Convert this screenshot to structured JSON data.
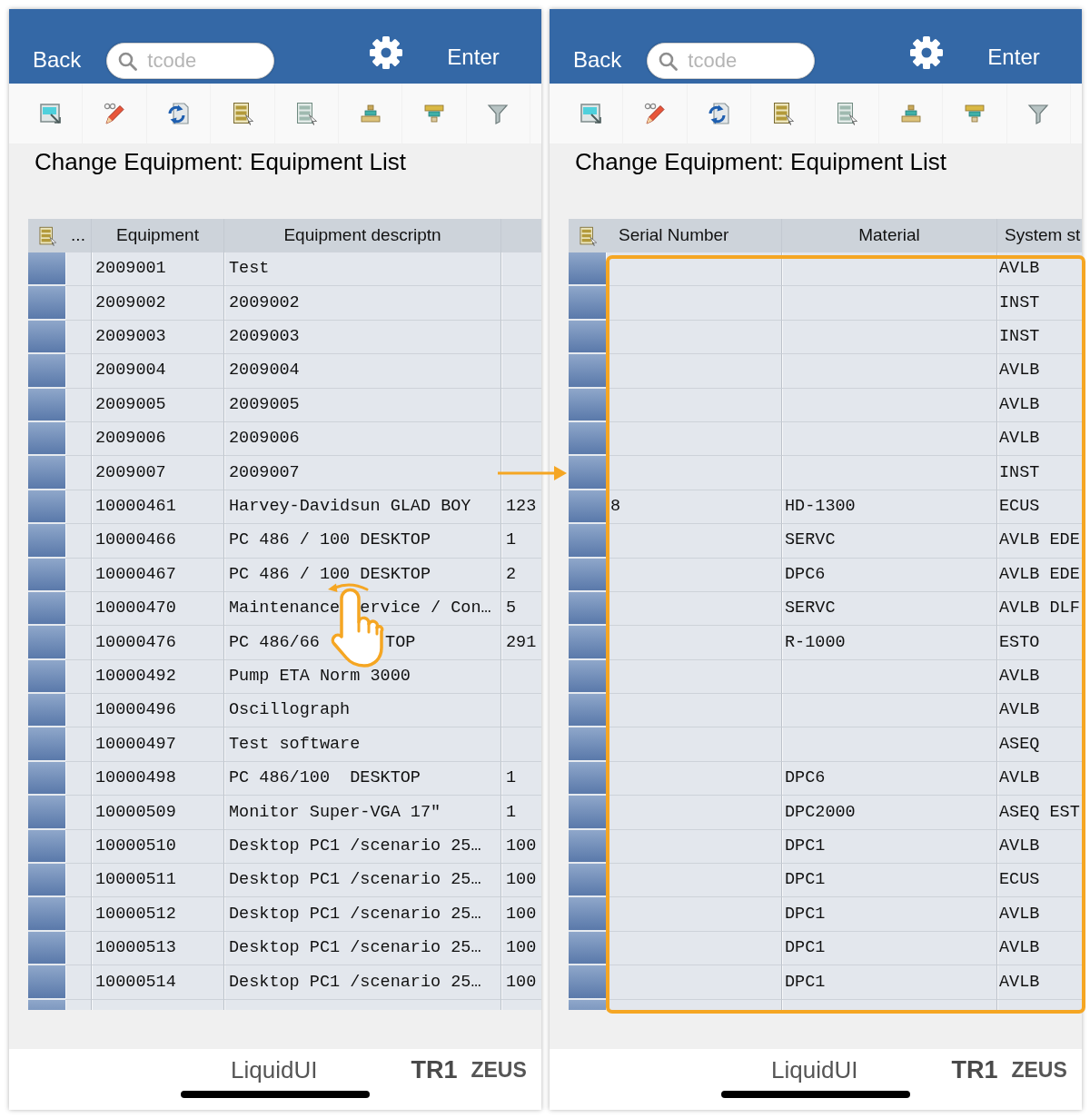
{
  "screens": [
    {
      "back_button": "Back",
      "search": {
        "placeholder": "tcode"
      },
      "enter_button": "Enter",
      "title": "Change Equipment: Equipment List",
      "table": {
        "columns": [
          "...",
          "Equipment",
          "Equipment descriptn"
        ],
        "rows": [
          {
            "selected": false,
            "equipment": "2009001",
            "description": "Test"
          },
          {
            "selected": false,
            "equipment": "2009002",
            "description": "2009002"
          },
          {
            "selected": false,
            "equipment": "2009003",
            "description": "2009003"
          },
          {
            "selected": false,
            "equipment": "2009004",
            "description": "2009004"
          },
          {
            "selected": false,
            "equipment": "2009005",
            "description": "2009005"
          },
          {
            "selected": false,
            "equipment": "2009006",
            "description": "2009006"
          },
          {
            "selected": false,
            "equipment": "2009007",
            "description": "2009007"
          },
          {
            "selected": false,
            "equipment": "10000461",
            "description": "Harvey-Davidsun GLAD BOY",
            "column_4": "123"
          },
          {
            "selected": false,
            "equipment": "10000466",
            "description": "PC 486 / 100 DESKTOP",
            "column_4": "1"
          },
          {
            "selected": false,
            "equipment": "10000467",
            "description": "PC 486 / 100 DESKTOP",
            "column_4": "2"
          },
          {
            "selected": false,
            "equipment": "10000470",
            "description": [
              "Maintenance",
              "ervice / Con…"
            ],
            "column_4": "5"
          },
          {
            "selected": false,
            "equipment": "10000476",
            "description": [
              "PC 486/66",
              "TOP"
            ],
            "column_4": "291"
          },
          {
            "selected": false,
            "equipment": "10000492",
            "description": "Pump ETA Norm 3000"
          },
          {
            "selected": false,
            "equipment": "10000496",
            "description": "Oscillograph"
          },
          {
            "selected": false,
            "equipment": "10000497",
            "description": "Test software"
          },
          {
            "selected": false,
            "equipment": "10000498",
            "description": "PC 486/100  DESKTOP",
            "column_4": "1"
          },
          {
            "selected": false,
            "equipment": "10000509",
            "description": "Monitor Super-VGA 17\"",
            "column_4": "1"
          },
          {
            "selected": false,
            "equipment": "10000510",
            "description": "Desktop PC1 /scenario 25…",
            "column_4": "100"
          },
          {
            "selected": false,
            "equipment": "10000511",
            "description": "Desktop PC1 /scenario 25…",
            "column_4": "100"
          },
          {
            "selected": false,
            "equipment": "10000512",
            "description": "Desktop PC1 /scenario 25…",
            "column_4": "100"
          },
          {
            "selected": false,
            "equipment": "10000513",
            "description": "Desktop PC1 /scenario 25…",
            "column_4": "100"
          },
          {
            "selected": false,
            "equipment": "10000514",
            "description": "Desktop PC1 /scenario 25…",
            "column_4": "100"
          }
        ]
      },
      "footer": {
        "app_name": "LiquidUI",
        "system": "TR1",
        "server": "ZEUS"
      }
    },
    {
      "back_button": "Back",
      "search": {
        "placeholder": "tcode"
      },
      "enter_button": "Enter",
      "title": "Change Equipment: Equipment List",
      "table": {
        "columns": [
          "Serial Number",
          "Material",
          "System st"
        ],
        "rows": [
          {
            "selected": false,
            "system_status": "AVLB"
          },
          {
            "selected": false,
            "system_status": "INST"
          },
          {
            "selected": false,
            "system_status": "INST"
          },
          {
            "selected": false,
            "system_status": "AVLB"
          },
          {
            "selected": false,
            "system_status": "AVLB"
          },
          {
            "selected": false,
            "system_status": "AVLB"
          },
          {
            "selected": false,
            "system_status": "INST"
          },
          {
            "selected": false,
            "serial_number": "8",
            "material": "HD-1300",
            "system_status": "ECUS"
          },
          {
            "selected": false,
            "material": "SERVC",
            "system_status": "AVLB EDE"
          },
          {
            "selected": false,
            "material": "DPC6",
            "system_status": "AVLB EDE"
          },
          {
            "selected": false,
            "material": "SERVC",
            "system_status": "AVLB DLF"
          },
          {
            "selected": false,
            "material": "R-1000",
            "system_status": "ESTO"
          },
          {
            "selected": false,
            "system_status": "AVLB"
          },
          {
            "selected": false,
            "system_status": "AVLB"
          },
          {
            "selected": false,
            "system_status": "ASEQ"
          },
          {
            "selected": false,
            "material": "DPC6",
            "system_status": "AVLB"
          },
          {
            "selected": false,
            "material": "DPC2000",
            "system_status": "ASEQ EST"
          },
          {
            "selected": false,
            "material": "DPC1",
            "system_status": "AVLB"
          },
          {
            "selected": false,
            "material": "DPC1",
            "system_status": "ECUS"
          },
          {
            "selected": false,
            "material": "DPC1",
            "system_status": "AVLB"
          },
          {
            "selected": false,
            "material": "DPC1",
            "system_status": "AVLB"
          },
          {
            "selected": false,
            "material": "DPC1",
            "system_status": "AVLB"
          }
        ]
      },
      "footer": {
        "app_name": "LiquidUI",
        "system": "TR1",
        "server": "ZEUS"
      }
    }
  ]
}
